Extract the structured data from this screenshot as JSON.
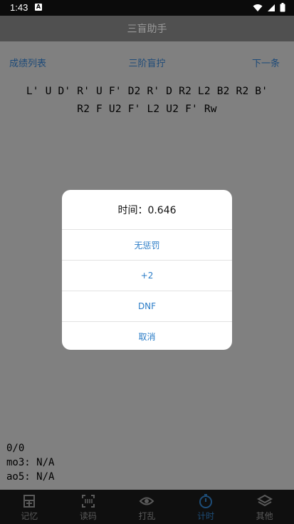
{
  "status": {
    "time": "1:43",
    "notification_glyph": "A"
  },
  "app_bar": {
    "title": "三盲助手"
  },
  "nav": {
    "left": "成绩列表",
    "center": "三阶盲拧",
    "right": "下一条"
  },
  "scramble": {
    "line1": "L' U D' R' U F' D2 R' D R2 L2 B2 R2 B'",
    "line2": "R2 F U2 F' L2 U2 F' Rw"
  },
  "timer": {
    "display": "0.646"
  },
  "stats": {
    "count": "0/0",
    "mo3": "mo3: N/A",
    "ao5": "ao5: N/A"
  },
  "dialog": {
    "title": "时间：0.646",
    "options": [
      "无惩罚",
      "+2",
      "DNF",
      "取消"
    ]
  },
  "bottom_nav": {
    "items": [
      {
        "label": "记忆",
        "icon": "memory-icon"
      },
      {
        "label": "读码",
        "icon": "scan-icon"
      },
      {
        "label": "打乱",
        "icon": "shuffle-icon"
      },
      {
        "label": "计时",
        "icon": "stopwatch-icon"
      },
      {
        "label": "其他",
        "icon": "layers-icon"
      }
    ],
    "active": "计时"
  },
  "colors": {
    "accent": "#2a7cc7",
    "nav_link": "#1d4a78",
    "overlay": "#808080"
  }
}
